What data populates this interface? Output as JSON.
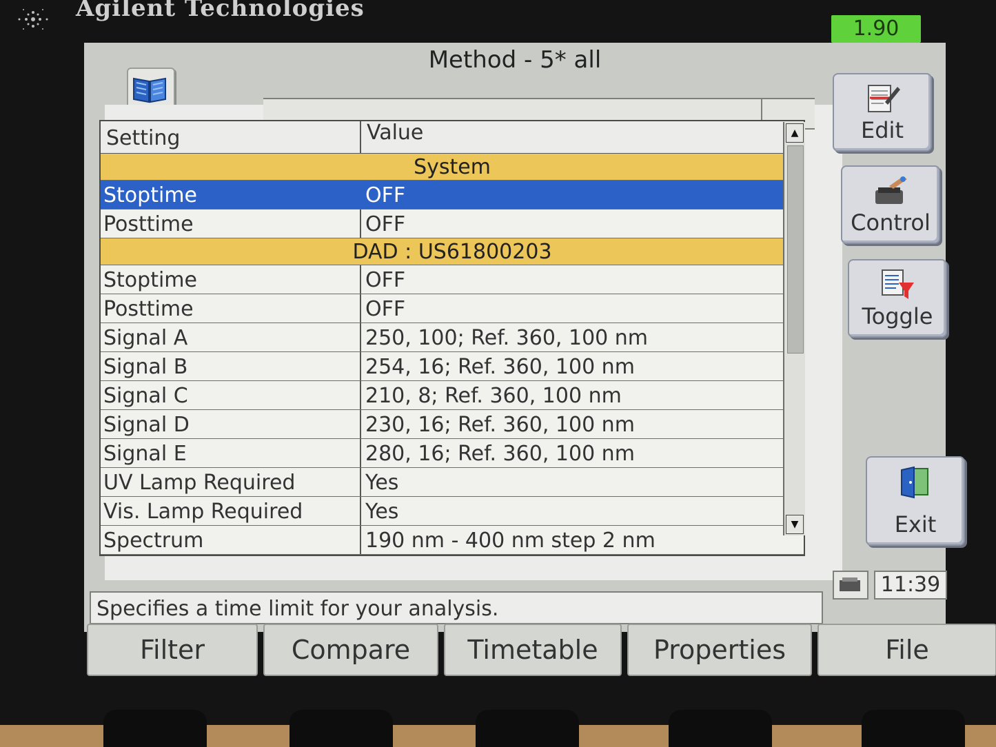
{
  "brand": "Agilent Technologies",
  "version": "1.90",
  "title": "Method - 5* all",
  "table": {
    "headers": {
      "setting": "Setting",
      "value": "Value"
    },
    "rows": [
      {
        "type": "group",
        "label": "System"
      },
      {
        "type": "item",
        "setting": "Stoptime",
        "value": "OFF",
        "selected": true
      },
      {
        "type": "item",
        "setting": "Posttime",
        "value": "OFF"
      },
      {
        "type": "group",
        "label": "DAD : US61800203"
      },
      {
        "type": "item",
        "setting": "Stoptime",
        "value": "OFF"
      },
      {
        "type": "item",
        "setting": "Posttime",
        "value": "OFF"
      },
      {
        "type": "item",
        "setting": "Signal A",
        "value": "250, 100; Ref. 360, 100 nm"
      },
      {
        "type": "item",
        "setting": "Signal B",
        "value": "254, 16; Ref. 360, 100 nm"
      },
      {
        "type": "item",
        "setting": "Signal C",
        "value": "210, 8; Ref. 360, 100 nm"
      },
      {
        "type": "item",
        "setting": "Signal D",
        "value": "230, 16; Ref. 360, 100 nm"
      },
      {
        "type": "item",
        "setting": "Signal E",
        "value": "280, 16; Ref. 360, 100 nm"
      },
      {
        "type": "item",
        "setting": "UV Lamp Required",
        "value": "Yes"
      },
      {
        "type": "item",
        "setting": "Vis. Lamp Required",
        "value": "Yes"
      },
      {
        "type": "item",
        "setting": "Spectrum",
        "value": "190 nm - 400 nm step 2 nm"
      }
    ]
  },
  "side_buttons": {
    "edit": "Edit",
    "control": "Control",
    "toggle": "Toggle",
    "exit": "Exit"
  },
  "status_text": "Specifies a time limit for your analysis.",
  "clock": "11:39",
  "softkeys": {
    "filter": "Filter",
    "compare": "Compare",
    "timetable": "Timetable",
    "properties": "Properties",
    "file": "File"
  },
  "icons": {
    "book": "book-icon",
    "edit": "edit-icon",
    "control": "control-icon",
    "toggle": "toggle-icon",
    "exit": "door-icon",
    "status": "device-icon"
  },
  "colors": {
    "group_row": "#edc65a",
    "selected_row": "#2c62c8",
    "version_badge": "#5fd13a"
  }
}
